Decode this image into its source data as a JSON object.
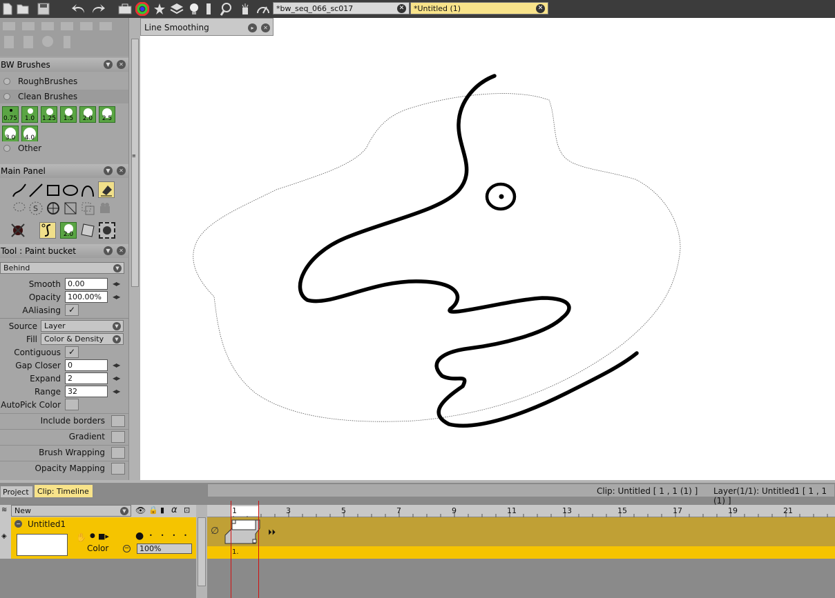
{
  "toolbar": {
    "icons": [
      "new-file-icon",
      "open-file-icon",
      "save-icon",
      "undo-icon",
      "redo-icon",
      "toolbox-icon",
      "color-wheel-icon",
      "palette-icon",
      "layers-icon",
      "lightbulb-icon",
      "list-icon",
      "magnifier-icon",
      "magic-hat-icon",
      "gauge-icon"
    ]
  },
  "tabs": [
    {
      "label": "*bw_seq_066_sc017",
      "active": false
    },
    {
      "label": "*Untitled (1)",
      "active": true
    }
  ],
  "line_smoothing": {
    "title": "Line Smoothing"
  },
  "bw_brushes": {
    "title": "BW Brushes",
    "groups": [
      "RoughBrushes",
      "Clean Brushes",
      "Other"
    ],
    "sizes": [
      "0.75",
      "1.0",
      "1.25",
      "1.5",
      "2.0",
      "2.5",
      "3.0",
      "4.0"
    ]
  },
  "main_panel": {
    "title": "Main Panel",
    "brush_size": "2.0"
  },
  "tool": {
    "title": "Tool : Paint bucket",
    "mode": "Behind",
    "smooth_label": "Smooth",
    "smooth": "0.00",
    "opacity_label": "Opacity",
    "opacity": "100.00%",
    "aaliasing_label": "AAliasing",
    "source_label": "Source",
    "source": "Layer",
    "fill_label": "Fill",
    "fill": "Color & Density",
    "contiguous_label": "Contiguous",
    "gap_closer_label": "Gap Closer",
    "gap_closer": "0",
    "expand_label": "Expand",
    "expand": "2",
    "range_label": "Range",
    "range": "32",
    "autopick_label": "AutoPick Color",
    "include_borders": "Include borders",
    "gradient": "Gradient",
    "brush_wrapping": "Brush Wrapping",
    "opacity_mapping": "Opacity Mapping"
  },
  "bottom_tabs": {
    "project": "Project",
    "clip_timeline": "Clip: Timeline"
  },
  "status": {
    "clip": "Clip: Untitled [ 1 , 1  (1) ]",
    "layer": "Layer(1/1): Untitled1 [ 1 , 1  (1) ]"
  },
  "timeline": {
    "new_label": "New",
    "layer_name": "Untitled1",
    "color_label": "Color",
    "opacity": "100%",
    "current_frame": "1",
    "frame_label": "1.",
    "ruler": [
      "3",
      "5",
      "7",
      "9",
      "11",
      "13",
      "15",
      "17",
      "19",
      "21"
    ]
  },
  "colors": {
    "accent_yellow": "#f5c400",
    "track_olive": "#c0a035",
    "brush_green": "#5aa544",
    "playhead_red": "#d01010"
  }
}
